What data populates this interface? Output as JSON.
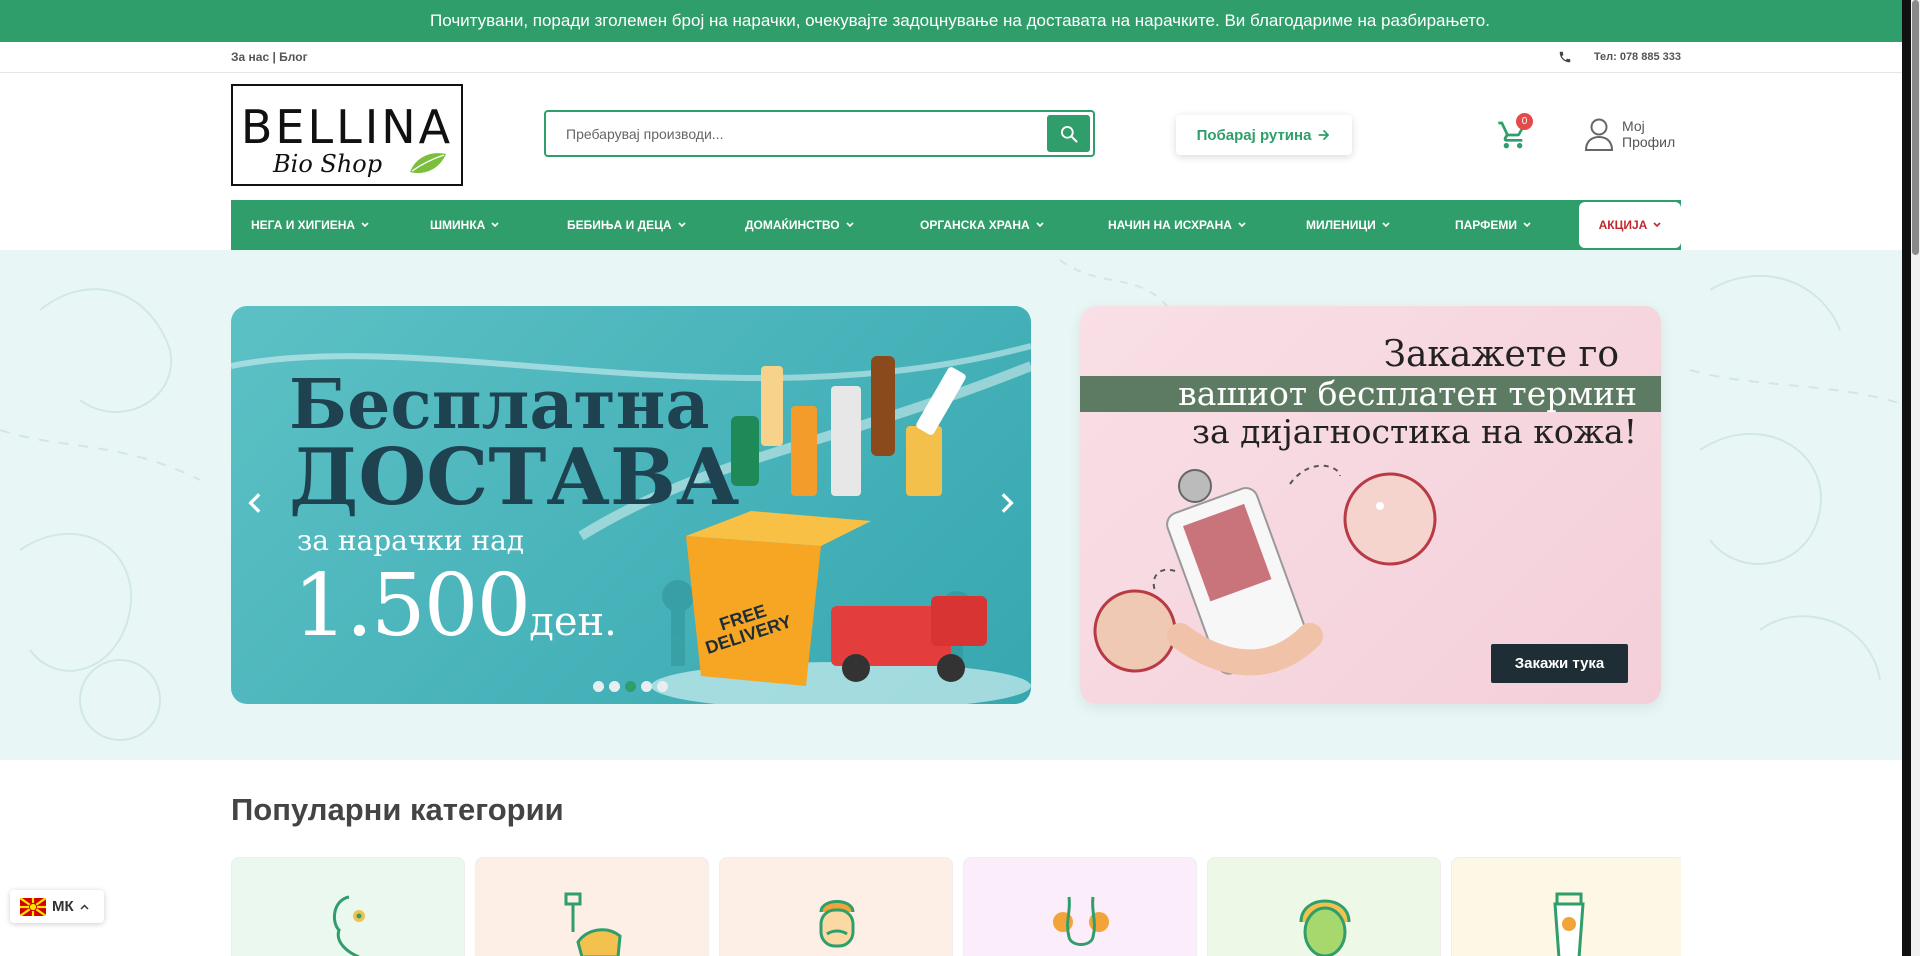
{
  "announcement": "Почитувани, поради зголемен број на нарачки, очекувајте задоцнување на доставата на нарачките. Ви благодариме на разбирањето.",
  "topbar": {
    "about": "За нас",
    "separator": " | ",
    "blog": "Блог",
    "phone_icon": "phone-icon",
    "phone": "Тел: 078 885 333"
  },
  "logo": {
    "brand": "BELLINA",
    "sub": "Bio Shop"
  },
  "search": {
    "placeholder": "Пребарувај производи..."
  },
  "routine_button": {
    "label": "Побарај рутина"
  },
  "cart": {
    "count": "0"
  },
  "profile": {
    "line1": "Мој",
    "line2": "Профил"
  },
  "nav": {
    "items": [
      {
        "label": "НЕГА И ХИГИЕНА"
      },
      {
        "label": "ШМИНКА"
      },
      {
        "label": "БЕБИЊА И ДЕЦА"
      },
      {
        "label": "ДОМАЌИНСТВО"
      },
      {
        "label": "ОРГАНСКА ХРАНА"
      },
      {
        "label": "НАЧИН НА ИСХРАНА"
      },
      {
        "label": "МИЛЕНИЦИ"
      },
      {
        "label": "ПАРФЕМИ"
      }
    ],
    "sale": "АКЦИЈА"
  },
  "slider": {
    "line1": "Бесплатна",
    "line2": "ДОСТАВА",
    "line3": "за нарачки над",
    "amount": "1.500",
    "currency": "ден.",
    "truck_text1": "FREE",
    "truck_text2": "DELIVERY",
    "dots": 5,
    "active_dot": 3
  },
  "promo": {
    "line1": "Закажете го",
    "line2": "вашиот бесплатен термин",
    "line3": "за дијагностика на кожа!",
    "cta": "Закажи тука"
  },
  "popular": {
    "title": "Популарни категории",
    "cards": [
      {
        "icon": "face-flower-icon",
        "bg": "#eaf8f0"
      },
      {
        "icon": "hand-wash-icon",
        "bg": "#fdeee6"
      },
      {
        "icon": "man-mustache-icon",
        "bg": "#fdeee6"
      },
      {
        "icon": "body-icon",
        "bg": "#fbeefa"
      },
      {
        "icon": "face-mask-icon",
        "bg": "#eef8e6"
      },
      {
        "icon": "sunscreen-icon",
        "bg": "#fdf8e6"
      }
    ]
  },
  "language": {
    "code": "МК"
  },
  "colors": {
    "primary": "#2f9e6a",
    "sale": "#c1272d",
    "dark": "#1f2e35"
  }
}
